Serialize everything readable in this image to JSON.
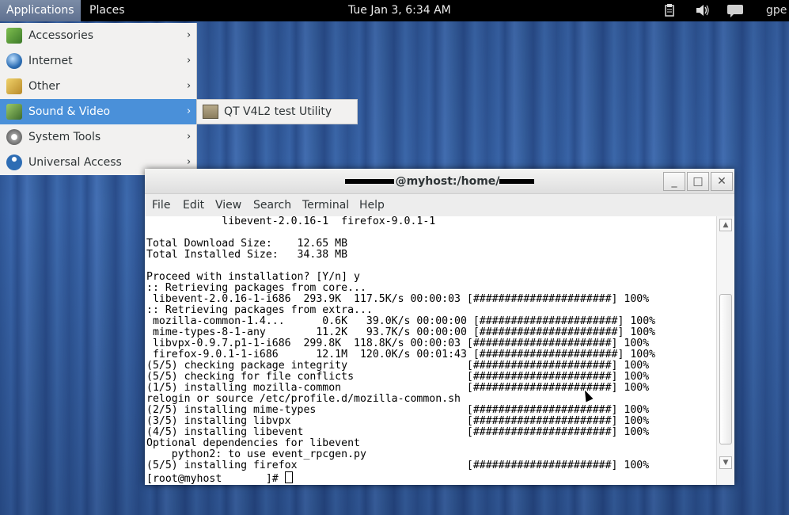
{
  "topbar": {
    "applications": "Applications",
    "places": "Places",
    "clock": "Tue Jan  3,  6:34 AM",
    "user_partial": "gpe",
    "tray_icons": [
      "clipboard-icon",
      "volume-icon",
      "chat-icon"
    ]
  },
  "app_menu": {
    "items": [
      {
        "label": "Accessories",
        "icon": "accessories-icon",
        "color": "#5a8f3c"
      },
      {
        "label": "Internet",
        "icon": "globe-icon",
        "color": "#3a6fb0"
      },
      {
        "label": "Other",
        "icon": "other-icon",
        "color": "#c7a13b"
      },
      {
        "label": "Sound & Video",
        "icon": "multimedia-icon",
        "color": "#4f7f3a"
      },
      {
        "label": "System Tools",
        "icon": "gear-icon",
        "color": "#888888"
      },
      {
        "label": "Universal Access",
        "icon": "accessibility-icon",
        "color": "#2e6db4"
      }
    ],
    "active_index": 3,
    "arrow": "›"
  },
  "submenu": {
    "label": "QT V4L2 test Utility",
    "icon": "video-device-icon"
  },
  "terminal": {
    "title": "@myhost:/home/",
    "buttons": {
      "minimize": "_",
      "maximize": "□",
      "close": "✕"
    },
    "menu": [
      "File",
      "Edit",
      "View",
      "Search",
      "Terminal",
      "Help"
    ],
    "lines": [
      "            libevent-2.0.16-1  firefox-9.0.1-1",
      "",
      "Total Download Size:    12.65 MB",
      "Total Installed Size:   34.38 MB",
      "",
      "Proceed with installation? [Y/n] y",
      ":: Retrieving packages from core...",
      " libevent-2.0.16-1-i686  293.9K  117.5K/s 00:00:03 [######################] 100%",
      ":: Retrieving packages from extra...",
      " mozilla-common-1.4...      0.6K   39.0K/s 00:00:00 [######################] 100%",
      " mime-types-8-1-any        11.2K   93.7K/s 00:00:00 [######################] 100%",
      " libvpx-0.9.7.p1-1-i686  299.8K  118.8K/s 00:00:03 [######################] 100%",
      " firefox-9.0.1-1-i686      12.1M  120.0K/s 00:01:43 [######################] 100%",
      "(5/5) checking package integrity                   [######################] 100%",
      "(5/5) checking for file conflicts                  [######################] 100%",
      "(1/5) installing mozilla-common                    [######################] 100%",
      "relogin or source /etc/profile.d/mozilla-common.sh",
      "(2/5) installing mime-types                        [######################] 100%",
      "(3/5) installing libvpx                            [######################] 100%",
      "(4/5) installing libevent                          [######################] 100%",
      "Optional dependencies for libevent",
      "    python2: to use event_rpcgen.py",
      "(5/5) installing firefox                           [######################] 100%"
    ],
    "prompt": "[root@myhost       ]# "
  }
}
